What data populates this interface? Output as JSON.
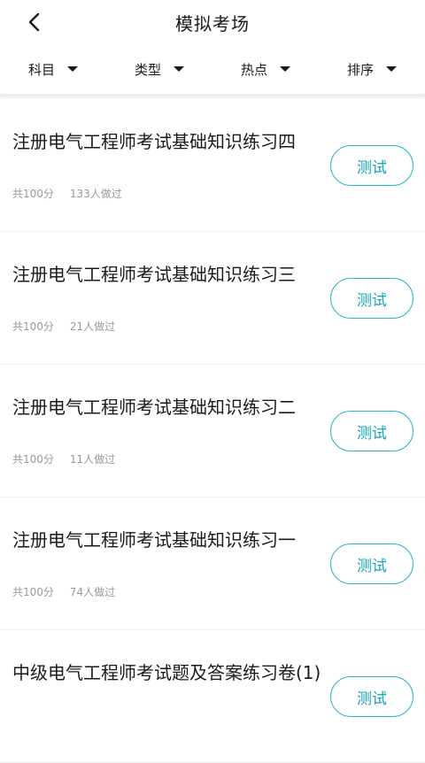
{
  "header": {
    "title": "模拟考场"
  },
  "filters": [
    {
      "label": "科目"
    },
    {
      "label": "类型"
    },
    {
      "label": "热点"
    },
    {
      "label": "排序"
    }
  ],
  "exams": [
    {
      "title": "注册电气工程师考试基础知识练习四",
      "score": "共100分",
      "takers": "133人做过",
      "button": "测试"
    },
    {
      "title": "注册电气工程师考试基础知识练习三",
      "score": "共100分",
      "takers": "21人做过",
      "button": "测试"
    },
    {
      "title": "注册电气工程师考试基础知识练习二",
      "score": "共100分",
      "takers": "11人做过",
      "button": "测试"
    },
    {
      "title": "注册电气工程师考试基础知识练习一",
      "score": "共100分",
      "takers": "74人做过",
      "button": "测试"
    },
    {
      "title": "中级电气工程师考试题及答案练习卷(1)",
      "button": "测试"
    }
  ],
  "colors": {
    "accent": "#29b6c8"
  }
}
